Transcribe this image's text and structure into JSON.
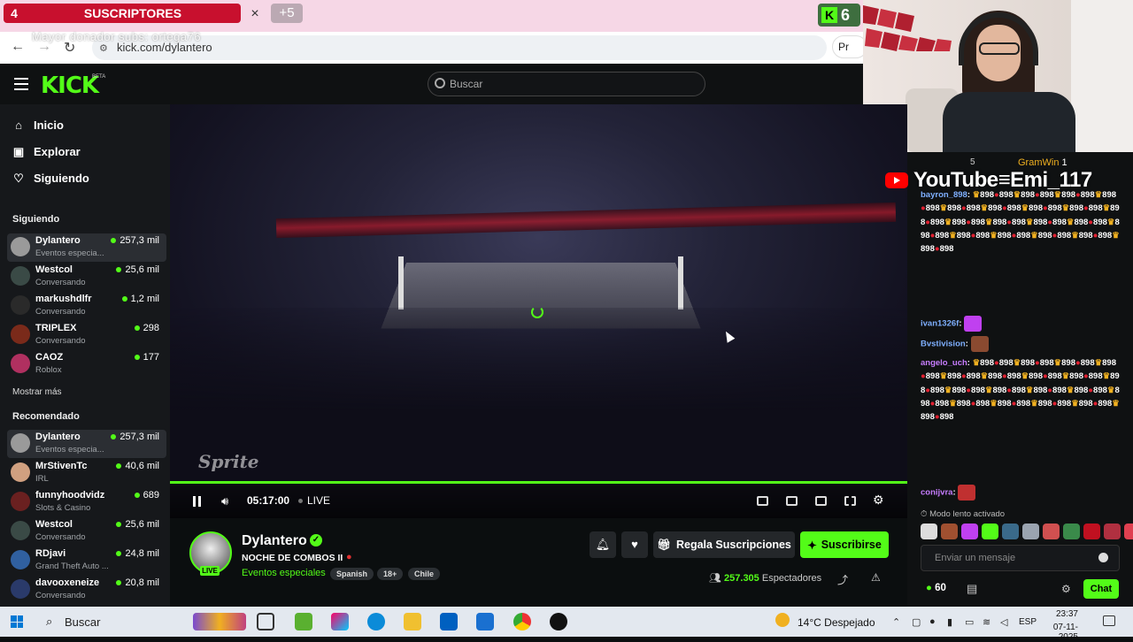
{
  "browser": {
    "sub_banner_count": "4",
    "sub_banner_label": "SUSCRIPTORES",
    "tab_close": "×",
    "tab_plus": "+5",
    "kick_counter": "6",
    "url": "kick.com/dylantero",
    "donor_overlay": "Mayor donador subs: ortega76",
    "pr_label": "Pr"
  },
  "header": {
    "logo": "KICK",
    "logo_badge": "BETA",
    "search_placeholder": "Buscar"
  },
  "sidebar": {
    "nav": [
      {
        "label": "Inicio",
        "icon": "home-icon"
      },
      {
        "label": "Explorar",
        "icon": "compass-icon"
      },
      {
        "label": "Siguiendo",
        "icon": "heart-icon"
      }
    ],
    "following_title": "Siguiendo",
    "following": [
      {
        "name": "Dylantero",
        "category": "Eventos especia...",
        "viewers": "257,3 mil"
      },
      {
        "name": "Westcol",
        "category": "Conversando",
        "viewers": "25,6 mil"
      },
      {
        "name": "markushdlfr",
        "category": "Conversando",
        "viewers": "1,2 mil"
      },
      {
        "name": "TRIPLEX",
        "category": "Conversando",
        "viewers": "298"
      },
      {
        "name": "CAOZ",
        "category": "Roblox",
        "viewers": "177"
      }
    ],
    "show_more": "Mostrar más",
    "recommended_title": "Recomendado",
    "recommended": [
      {
        "name": "Dylantero",
        "category": "Eventos especia...",
        "viewers": "257,3 mil"
      },
      {
        "name": "MrStivenTc",
        "category": "IRL",
        "viewers": "40,6 mil"
      },
      {
        "name": "funnyhoodvidz",
        "category": "Slots & Casino",
        "viewers": "689"
      },
      {
        "name": "Westcol",
        "category": "Conversando",
        "viewers": "25,6 mil"
      },
      {
        "name": "RDjavi",
        "category": "Grand Theft Auto ...",
        "viewers": "24,8 mil"
      },
      {
        "name": "davooxeneize",
        "category": "Conversando",
        "viewers": "20,8 mil"
      }
    ]
  },
  "player": {
    "watermark": "Sprite",
    "time": "05:17:00",
    "live_label": "LIVE",
    "progress": 1.0
  },
  "stream": {
    "streamer": "Dylantero",
    "live_badge": "LIVE",
    "title": "NOCHE DE COMBOS II",
    "category": "Eventos especiales",
    "tags": [
      "Spanish",
      "18+",
      "Chile"
    ],
    "gift_label": "Regala Suscripciones",
    "subscribe_label": "Suscribirse",
    "viewers": "257.305",
    "viewers_label": "Espectadores"
  },
  "chat": {
    "overlay_top_count": "5",
    "gramwin": "GramWin",
    "gramwin_count": "1",
    "youtube_overlay": "YouTube≡Emi_117",
    "messages": [
      {
        "user": "bayron_898",
        "user_color": "#7fb0ff",
        "spam": true
      },
      {
        "user": "ivan1326f",
        "user_color": "#7fb0ff",
        "emote": true
      },
      {
        "user": "Bvstivision",
        "user_color": "#7fb0ff",
        "emote": true
      },
      {
        "user": "angelo_uch",
        "user_color": "#c77dff",
        "spam": true
      },
      {
        "user": "conijvra",
        "user_color": "#c77dff",
        "emote": true
      }
    ],
    "spam_token": "898",
    "slow_mode": "Modo lento activado",
    "input_placeholder": "Enviar un mensaje",
    "points": "60",
    "chat_button": "Chat"
  },
  "taskbar": {
    "search": "Buscar",
    "weather": "14°C Despejado",
    "lang": "ESP",
    "time": "23:37",
    "date": "07-11-2025"
  }
}
